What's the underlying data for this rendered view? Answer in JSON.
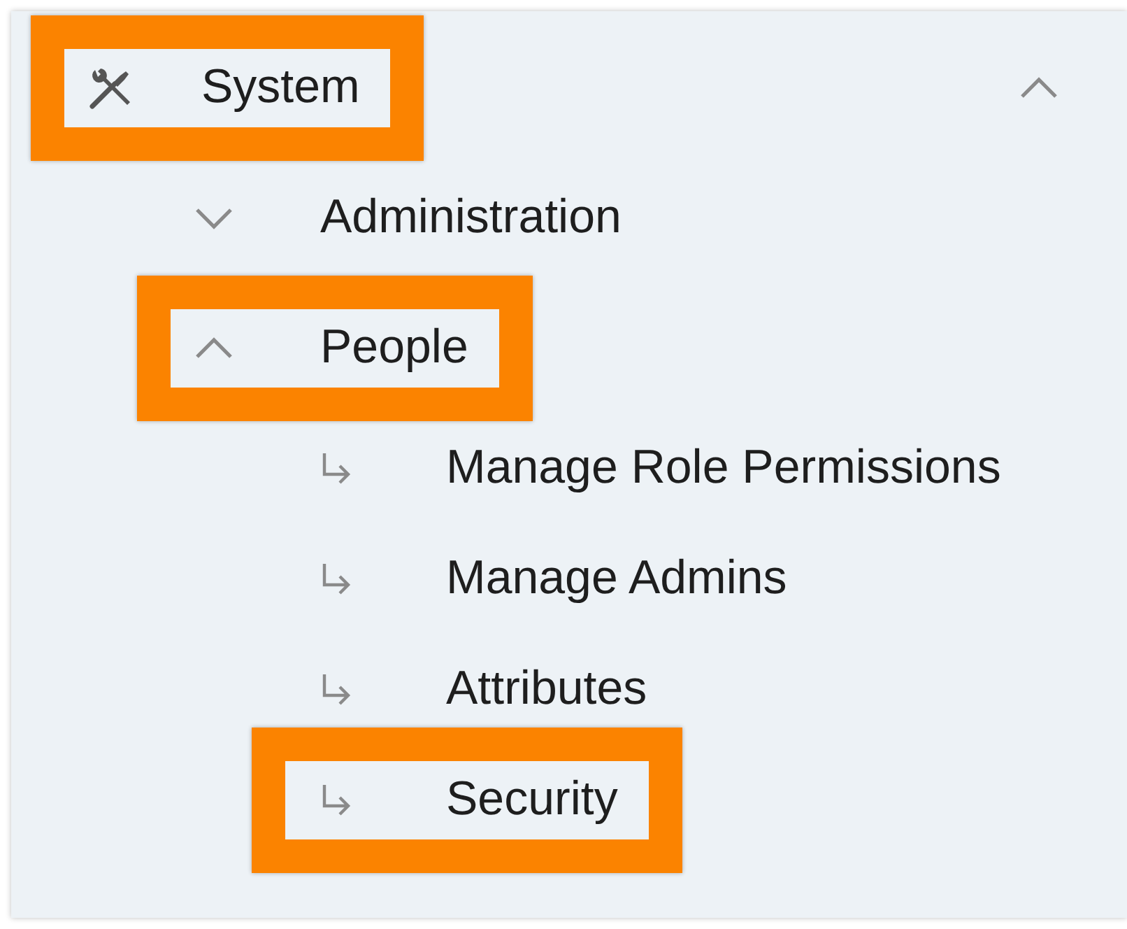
{
  "menu": {
    "items": [
      {
        "label": "System",
        "expanded": true,
        "highlighted": true,
        "children": [
          {
            "label": "Administration",
            "expanded": false,
            "highlighted": false
          },
          {
            "label": "People",
            "expanded": true,
            "highlighted": true,
            "children": [
              {
                "label": "Manage Role Permissions",
                "highlighted": false
              },
              {
                "label": "Manage Admins",
                "highlighted": false
              },
              {
                "label": "Attributes",
                "highlighted": false
              },
              {
                "label": "Security",
                "highlighted": true
              }
            ]
          }
        ]
      }
    ]
  }
}
